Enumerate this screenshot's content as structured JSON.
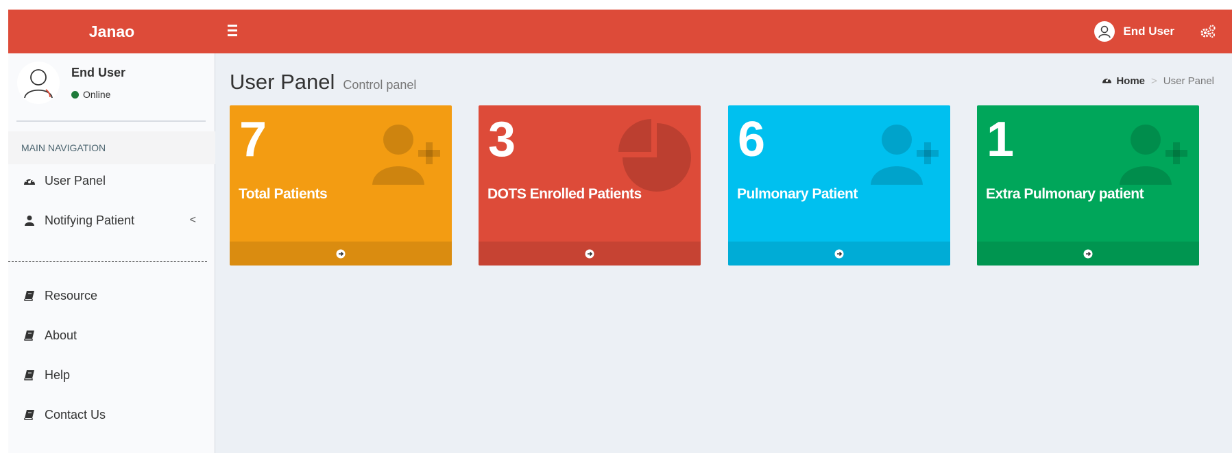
{
  "header": {
    "logo": "Janao",
    "user_name": "End User"
  },
  "sidebar": {
    "user": {
      "name": "End User",
      "status": "Online"
    },
    "nav_header": "MAIN NAVIGATION",
    "items": [
      {
        "label": "User Panel",
        "icon": "dashboard-icon"
      },
      {
        "label": "Notifying Patient",
        "icon": "user-icon",
        "chevron": "<"
      },
      {
        "label": "Resource",
        "icon": "book-icon"
      },
      {
        "label": "About",
        "icon": "book-icon"
      },
      {
        "label": "Help",
        "icon": "book-icon"
      },
      {
        "label": "Contact Us",
        "icon": "book-icon"
      }
    ]
  },
  "content": {
    "title": "User Panel",
    "subtitle": "Control panel",
    "breadcrumb": {
      "home": "Home",
      "sep": ">",
      "current": "User Panel"
    }
  },
  "boxes": [
    {
      "value": "7",
      "label": "Total Patients",
      "color": "#f39c12",
      "icon": "user-plus-icon"
    },
    {
      "value": "3",
      "label": "DOTS Enrolled Patients",
      "color": "#dd4b39",
      "icon": "pie-chart-icon"
    },
    {
      "value": "6",
      "label": "Pulmonary Patient",
      "color": "#00c0ef",
      "icon": "user-plus-icon"
    },
    {
      "value": "1",
      "label": "Extra Pulmonary patient",
      "color": "#00a65a",
      "icon": "user-plus-icon"
    }
  ],
  "colors": {
    "header": "#dd4b39",
    "sidebar": "#f9fafc",
    "content_bg": "#ecf0f5"
  }
}
